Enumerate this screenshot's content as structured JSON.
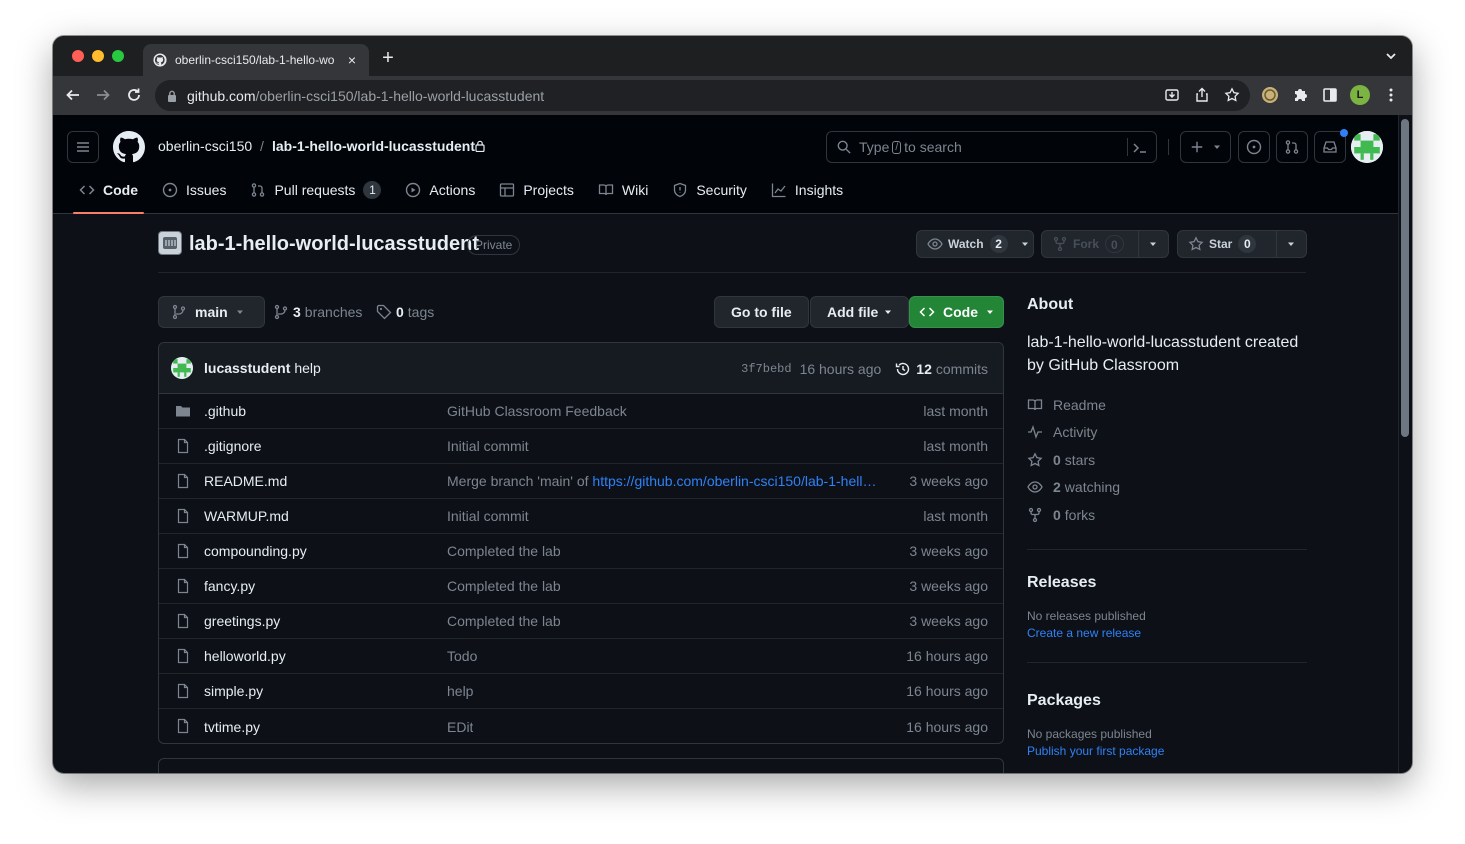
{
  "browser": {
    "tab_title": "oberlin-csci150/lab-1-hello-wo",
    "url_host": "github.com",
    "url_path": "/oberlin-csci150/lab-1-hello-world-lucasstudent",
    "profile_initial": "L"
  },
  "header": {
    "owner": "oberlin-csci150",
    "separator": "/",
    "repo": "lab-1-hello-world-lucasstudent",
    "search_prefix": "Type",
    "search_key": "/",
    "search_suffix": "to search"
  },
  "repo_nav": {
    "tabs": [
      {
        "label": "Code",
        "icon": "code-icon"
      },
      {
        "label": "Issues",
        "icon": "issue-icon"
      },
      {
        "label": "Pull requests",
        "icon": "pull-request-icon",
        "count": "1"
      },
      {
        "label": "Actions",
        "icon": "play-icon"
      },
      {
        "label": "Projects",
        "icon": "table-icon"
      },
      {
        "label": "Wiki",
        "icon": "book-icon"
      },
      {
        "label": "Security",
        "icon": "shield-icon"
      },
      {
        "label": "Insights",
        "icon": "graph-icon"
      }
    ]
  },
  "repo_title": {
    "name": "lab-1-hello-world-lucasstudent",
    "visibility": "Private",
    "watch_label": "Watch",
    "watch_count": "2",
    "fork_label": "Fork",
    "fork_count": "0",
    "star_label": "Star",
    "star_count": "0"
  },
  "file_nav": {
    "branch": "main",
    "branches_count": "3",
    "branches_label": "branches",
    "tags_count": "0",
    "tags_label": "tags",
    "go_to_file": "Go to file",
    "add_file": "Add file",
    "code": "Code"
  },
  "latest_commit": {
    "author": "lucasstudent",
    "message": "help",
    "sha": "3f7bebd",
    "time": "16 hours ago",
    "commits_count": "12",
    "commits_label": "commits"
  },
  "files": [
    {
      "name": ".github",
      "type": "folder",
      "commit": "GitHub Classroom Feedback",
      "time": "last month"
    },
    {
      "name": ".gitignore",
      "type": "file",
      "commit": "Initial commit",
      "time": "last month"
    },
    {
      "name": "README.md",
      "type": "file",
      "commit": "Merge branch 'main' of ",
      "commit_link": "https://github.com/oberlin-csci150/lab-1-hell…",
      "time": "3 weeks ago"
    },
    {
      "name": "WARMUP.md",
      "type": "file",
      "commit": "Initial commit",
      "time": "last month"
    },
    {
      "name": "compounding.py",
      "type": "file",
      "commit": "Completed the lab",
      "time": "3 weeks ago"
    },
    {
      "name": "fancy.py",
      "type": "file",
      "commit": "Completed the lab",
      "time": "3 weeks ago"
    },
    {
      "name": "greetings.py",
      "type": "file",
      "commit": "Completed the lab",
      "time": "3 weeks ago"
    },
    {
      "name": "helloworld.py",
      "type": "file",
      "commit": "Todo",
      "time": "16 hours ago"
    },
    {
      "name": "simple.py",
      "type": "file",
      "commit": "help",
      "time": "16 hours ago"
    },
    {
      "name": "tvtime.py",
      "type": "file",
      "commit": "EDit",
      "time": "16 hours ago"
    }
  ],
  "about": {
    "heading": "About",
    "description": "lab-1-hello-world-lucasstudent created by GitHub Classroom",
    "readme": "Readme",
    "activity": "Activity",
    "stars_count": "0",
    "stars_label": "stars",
    "watching_count": "2",
    "watching_label": "watching",
    "forks_count": "0",
    "forks_label": "forks"
  },
  "releases": {
    "heading": "Releases",
    "empty": "No releases published",
    "link": "Create a new release"
  },
  "packages": {
    "heading": "Packages",
    "empty": "No packages published",
    "link": "Publish your first package"
  },
  "colors": {
    "bg": "#0d1117",
    "header_bg": "#010409",
    "text": "#e6edf3",
    "muted": "#7d8590",
    "link": "#2f81f7",
    "green_button": "#238636",
    "active_tab_underline": "#f78166"
  }
}
